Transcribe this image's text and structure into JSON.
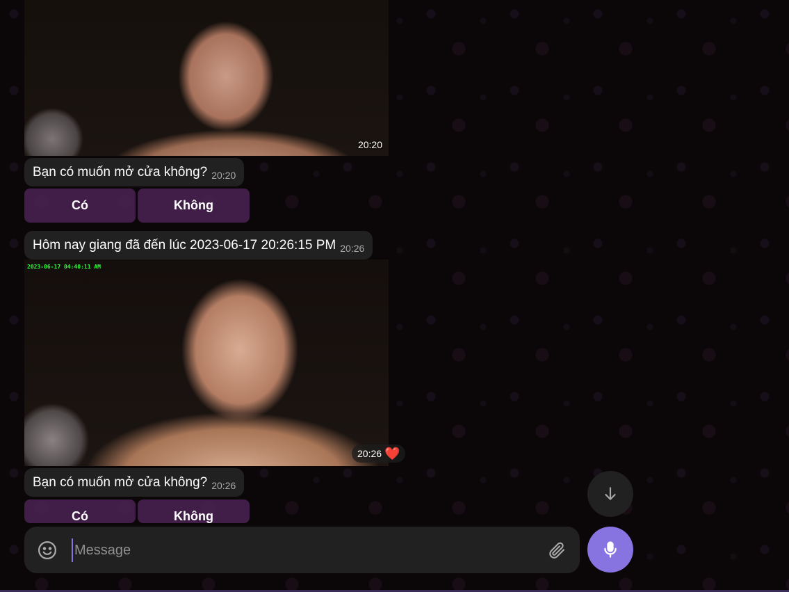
{
  "messages": {
    "photo1": {
      "time": "20:20"
    },
    "question1": {
      "text": "Bạn có muốn mở cửa không?",
      "time": "20:20"
    },
    "keyboard1": {
      "yes": "Có",
      "no": "Không"
    },
    "arrival": {
      "text": "Hôm nay giang đã đến lúc 2023-06-17 20:26:15 PM",
      "time": "20:26"
    },
    "photo2": {
      "camera_timestamp": "2023-06-17 04:40:11 AM",
      "time": "20:26",
      "reaction": "❤️"
    },
    "question2": {
      "text": "Bạn có muốn mở cửa không?",
      "time": "20:26"
    },
    "keyboard2": {
      "yes": "Có",
      "no": "Không"
    }
  },
  "composer": {
    "placeholder": "Message"
  },
  "icons": {
    "emoji": "smile-icon",
    "attach": "paperclip-icon",
    "mic": "microphone-icon",
    "scroll": "arrow-down-icon",
    "reaction": "heart-icon"
  },
  "colors": {
    "accent": "#8774e1",
    "bubble": "#212121",
    "keyboard_button": "#55285f",
    "camera_timestamp": "#2bff3a",
    "heart": "#e11d2e"
  }
}
